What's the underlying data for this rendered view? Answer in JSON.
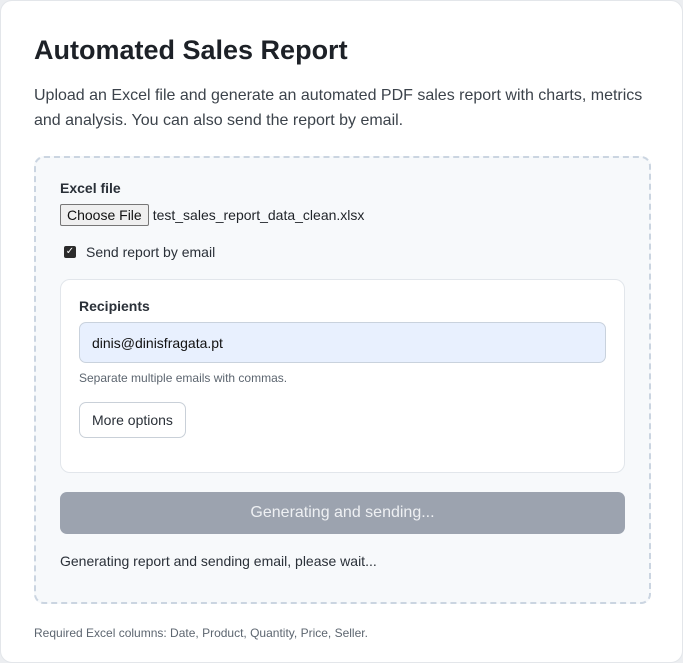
{
  "page": {
    "title": "Automated Sales Report",
    "intro": "Upload an Excel file and generate an automated PDF sales report with charts, metrics and analysis. You can also send the report by email."
  },
  "form": {
    "excel_label": "Excel file",
    "choose_file_label": "Choose File",
    "file_name": "test_sales_report_data_clean.xlsx",
    "send_email_label": "Send report by email",
    "send_email_checked": true,
    "recipients": {
      "label": "Recipients",
      "value": "dinis@dinisfragata.pt",
      "hint": "Separate multiple emails with commas.",
      "more_options_label": "More options"
    },
    "submit_label": "Generating and sending...",
    "status_text": "Generating report and sending email, please wait..."
  },
  "footer": {
    "note": "Required Excel columns: Date, Product, Quantity, Price, Seller."
  },
  "colors": {
    "submit_disabled": "#9ca3af",
    "input_bg": "#e8f0fe",
    "panel_border": "#cbd5e1"
  }
}
